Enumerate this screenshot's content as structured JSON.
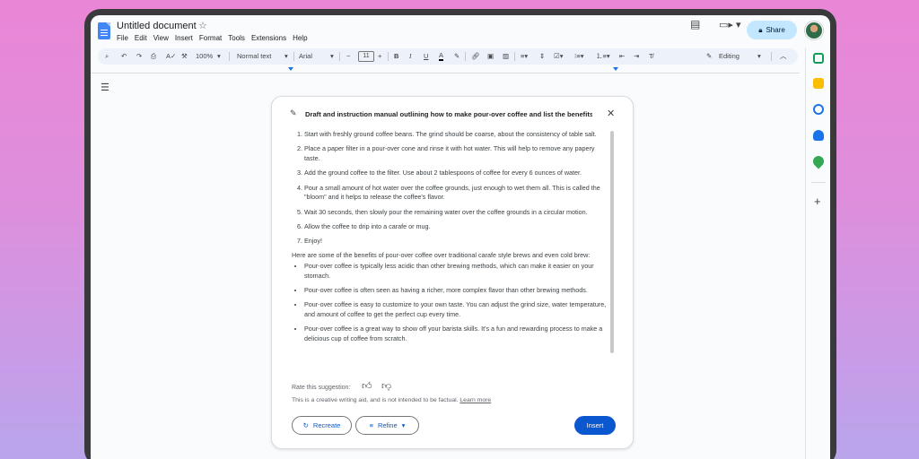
{
  "doc": {
    "title": "Untitled document",
    "menu": [
      "File",
      "Edit",
      "View",
      "Insert",
      "Format",
      "Tools",
      "Extensions",
      "Help"
    ],
    "share_label": "Share"
  },
  "toolbar": {
    "zoom": "100%",
    "style": "Normal text",
    "font": "Arial",
    "font_size": "11",
    "mode": "Editing"
  },
  "suggestion": {
    "prompt": "Draft and instruction manual outlining how to make pour-over coffee and list the benefits th",
    "steps": [
      "Start with freshly ground coffee beans. The grind should be coarse, about the consistency of table salt.",
      "Place a paper filter in a pour-over cone and rinse it with hot water. This will help to remove any papery taste.",
      "Add the ground coffee to the filter. Use about 2 tablespoons of coffee for every 6 ounces of water.",
      "Pour a small amount of hot water over the coffee grounds, just enough to wet them all. This is called the \"bloom\" and it helps to release the coffee's flavor.",
      "Wait 30 seconds, then slowly pour the remaining water over the coffee grounds in a circular motion.",
      "Allow the coffee to drip into a carafe or mug.",
      "Enjoy!"
    ],
    "benefits_intro": "Here are some of the benefits of pour-over coffee over traditional carafe style brews and even cold brew:",
    "benefits": [
      "Pour-over coffee is typically less acidic than other brewing methods, which can make it easier on your stomach.",
      "Pour-over coffee is often seen as having a richer, more complex flavor than other brewing methods.",
      "Pour-over coffee is easy to customize to your own taste. You can adjust the grind size, water temperature, and amount of coffee to get the perfect cup every time.",
      "Pour-over coffee is a great way to show off your barista skills. It's a fun and rewarding process to make a delicious cup of coffee from scratch."
    ],
    "rate_label": "Rate this suggestion:",
    "disclaimer": "This is a creative writing aid, and is not intended to be factual.",
    "learn_more": "Learn more",
    "recreate_label": "Recreate",
    "refine_label": "Refine",
    "insert_label": "Insert"
  },
  "colors": {
    "accent": "#0b57d0",
    "share_bg": "#c2e7ff"
  }
}
